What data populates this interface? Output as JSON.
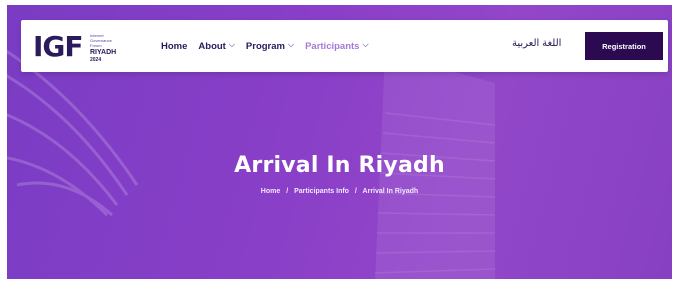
{
  "logo": {
    "mark": "IGF",
    "small_lines": [
      "Internet",
      "Governance",
      "Forum"
    ],
    "city": "RIYADH",
    "year": "2024"
  },
  "nav": {
    "items": [
      {
        "label": "Home",
        "dropdown": false
      },
      {
        "label": "About",
        "dropdown": true
      },
      {
        "label": "Program",
        "dropdown": true
      },
      {
        "label": "Participants",
        "dropdown": true,
        "active": true
      }
    ],
    "language_label": "اللغة العربية",
    "register_label": "Registration"
  },
  "hero": {
    "title": "Arrival In Riyadh",
    "breadcrumb": [
      "Home",
      "Participants Info",
      "Arrival In Riyadh"
    ],
    "separator": "/"
  },
  "colors": {
    "brand_dark": "#2b0a52",
    "hero_purple": "#8a3fc8",
    "active_link": "#a57ad6"
  }
}
